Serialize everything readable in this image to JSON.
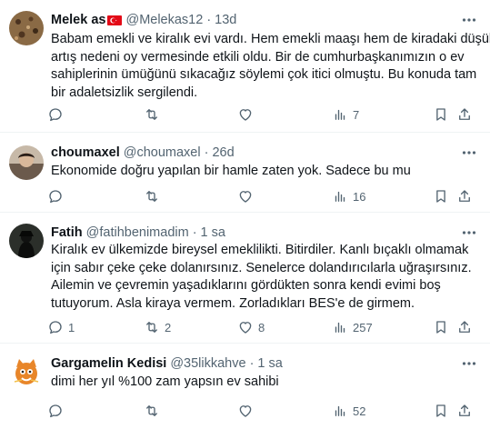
{
  "tweets": [
    {
      "name": "Melek as",
      "handle": "@Melekas12",
      "dot": "·",
      "time": "13d",
      "lines": [
        "Babam emekli ve kiralık evi vardı. Hem emekli maaşı hem de kiradaki düşük",
        "artış nedeni oy vermesinde etkili oldu. Bir de cumhurbaşkanımızın o ev",
        "sahiplerinin ümüğünü sıkacağız söylemi çok itici olmuştu. Bu konuda tam",
        "bir adaletsizlik sergilendi."
      ],
      "replies": "",
      "retweets": "",
      "likes": "",
      "views": "7"
    },
    {
      "name": "choumaxel",
      "handle": "@choumaxel",
      "dot": "·",
      "time": "26d",
      "lines": [
        "Ekonomide doğru yapılan bir hamle zaten yok. Sadece bu mu"
      ],
      "replies": "",
      "retweets": "",
      "likes": "",
      "views": "16"
    },
    {
      "name": "Fatih",
      "handle": "@fatihbenimadim",
      "dot": "·",
      "time": "1 sa",
      "lines": [
        "Kiralık ev ülkemizde bireysel emeklilikti. Bitirdiler.  Kanlı bıçaklı olmamak",
        "için sabır çeke çeke dolanırsınız. Senelerce dolandırıcılarla uğraşırsınız.",
        "Ailemin ve çevremin yaşadıklarını gördükten sonra kendi evimi boş",
        "tutuyorum. Asla kiraya vermem. Zorladıkları BES'e de girmem."
      ],
      "replies": "1",
      "retweets": "2",
      "likes": "8",
      "views": "257"
    },
    {
      "name": "Gargamelin Kedisi",
      "handle": "@35likkahve",
      "dot": "·",
      "time": "1 sa",
      "lines": [
        "dimi her yıl %100 zam yapsın ev sahibi"
      ],
      "replies": "",
      "retweets": "",
      "likes": "",
      "views": "52"
    }
  ],
  "icons": {
    "more": "more-horizontal-icon",
    "reply": "reply-icon",
    "retweet": "retweet-icon",
    "like": "like-icon",
    "views": "views-icon",
    "bookmark": "bookmark-icon",
    "share": "share-icon",
    "flag": "turkey-flag-icon"
  },
  "colors": {
    "text": "#0f1419",
    "secondary": "#536471",
    "divider": "#eff3f4",
    "flag_red": "#e30a17"
  }
}
